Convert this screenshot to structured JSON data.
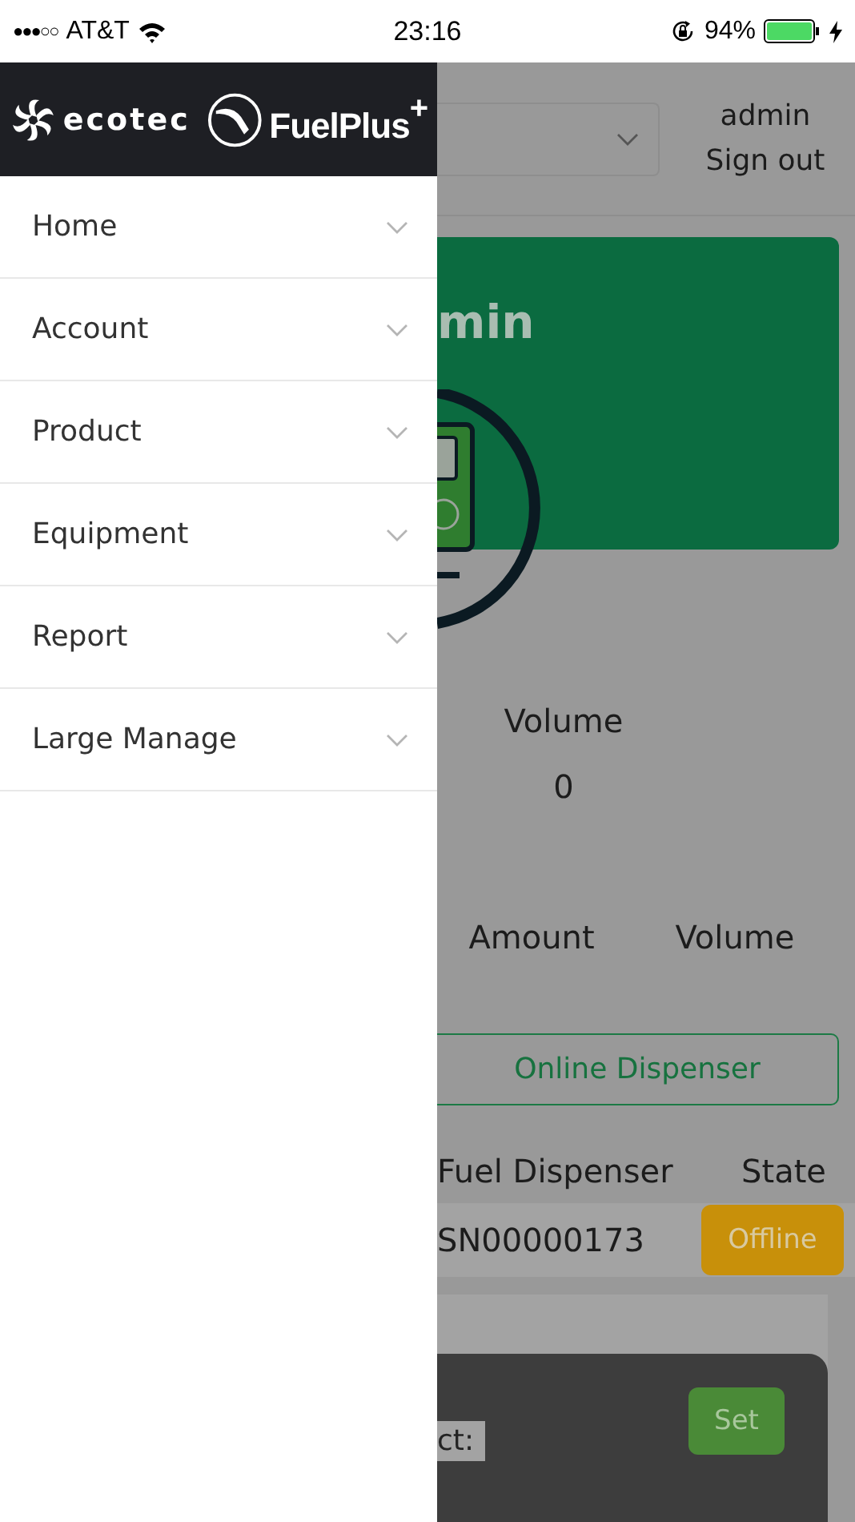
{
  "status_bar": {
    "signal": "●●●○○",
    "carrier": "AT&T",
    "time": "23:16",
    "battery": "94%"
  },
  "drawer": {
    "logo": {
      "brand": "ecotec",
      "product": "FuelPlus",
      "mark": "+"
    },
    "items": [
      {
        "label": "Home",
        "expanded": false
      },
      {
        "label": "Account",
        "expanded": false
      },
      {
        "label": "Product",
        "expanded": false
      },
      {
        "label": "Equipment",
        "expanded": false
      },
      {
        "label": "Report",
        "expanded": false
      },
      {
        "label": "Large Manage",
        "expanded": false
      }
    ]
  },
  "page": {
    "header": {
      "user": "admin",
      "sign_out": "Sign out"
    },
    "greeting_card": {
      "title": "min"
    },
    "summary": {
      "label": "Volume",
      "value": "0"
    },
    "totals_columns": [
      "Amount",
      "Volume"
    ],
    "online_button": "Online Dispenser",
    "table": {
      "columns": [
        "Fuel Dispenser",
        "State"
      ],
      "rows": [
        {
          "dispenser": "SN00000173",
          "state": "Offline",
          "kind": "offline"
        }
      ]
    },
    "dialog": {
      "label": "ct:",
      "button": "Set"
    }
  }
}
